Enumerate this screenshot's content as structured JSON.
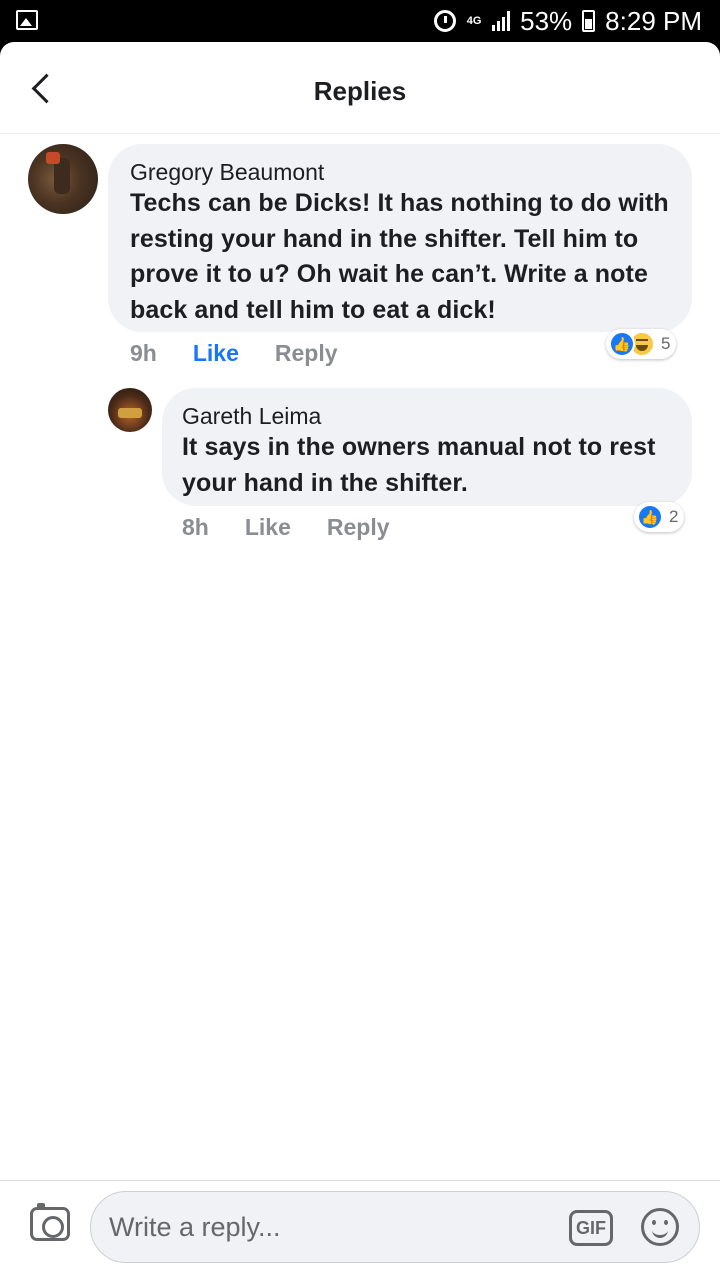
{
  "status_bar": {
    "network": "4G",
    "battery": "53%",
    "time": "8:29 PM"
  },
  "header": {
    "title": "Replies",
    "back_icon": "chevron-left-icon"
  },
  "comments": [
    {
      "author": "Gregory Beaumont",
      "text": "Techs can be Dicks! It has nothing to do with resting your hand in the shifter. Tell him to prove it to u? Oh wait he can’t. Write a note back and tell him to eat a dick!",
      "time": "9h",
      "like_label": "Like",
      "reply_label": "Reply",
      "liked": true,
      "reactions": [
        "like-icon",
        "haha-icon"
      ],
      "reaction_count": "5"
    },
    {
      "author": "Gareth Leima",
      "text": "It says in the owners manual not to rest your hand in the shifter.",
      "time": "8h",
      "like_label": "Like",
      "reply_label": "Reply",
      "liked": false,
      "reactions": [
        "like-icon"
      ],
      "reaction_count": "2"
    }
  ],
  "composer": {
    "placeholder": "Write a reply...",
    "gif_label": "GIF",
    "camera_icon": "camera-icon",
    "emoji_icon": "emoji-icon"
  },
  "colors": {
    "accent": "#1877f2",
    "bubble": "#f0f2f5",
    "secondary_text": "#8a8d91"
  }
}
